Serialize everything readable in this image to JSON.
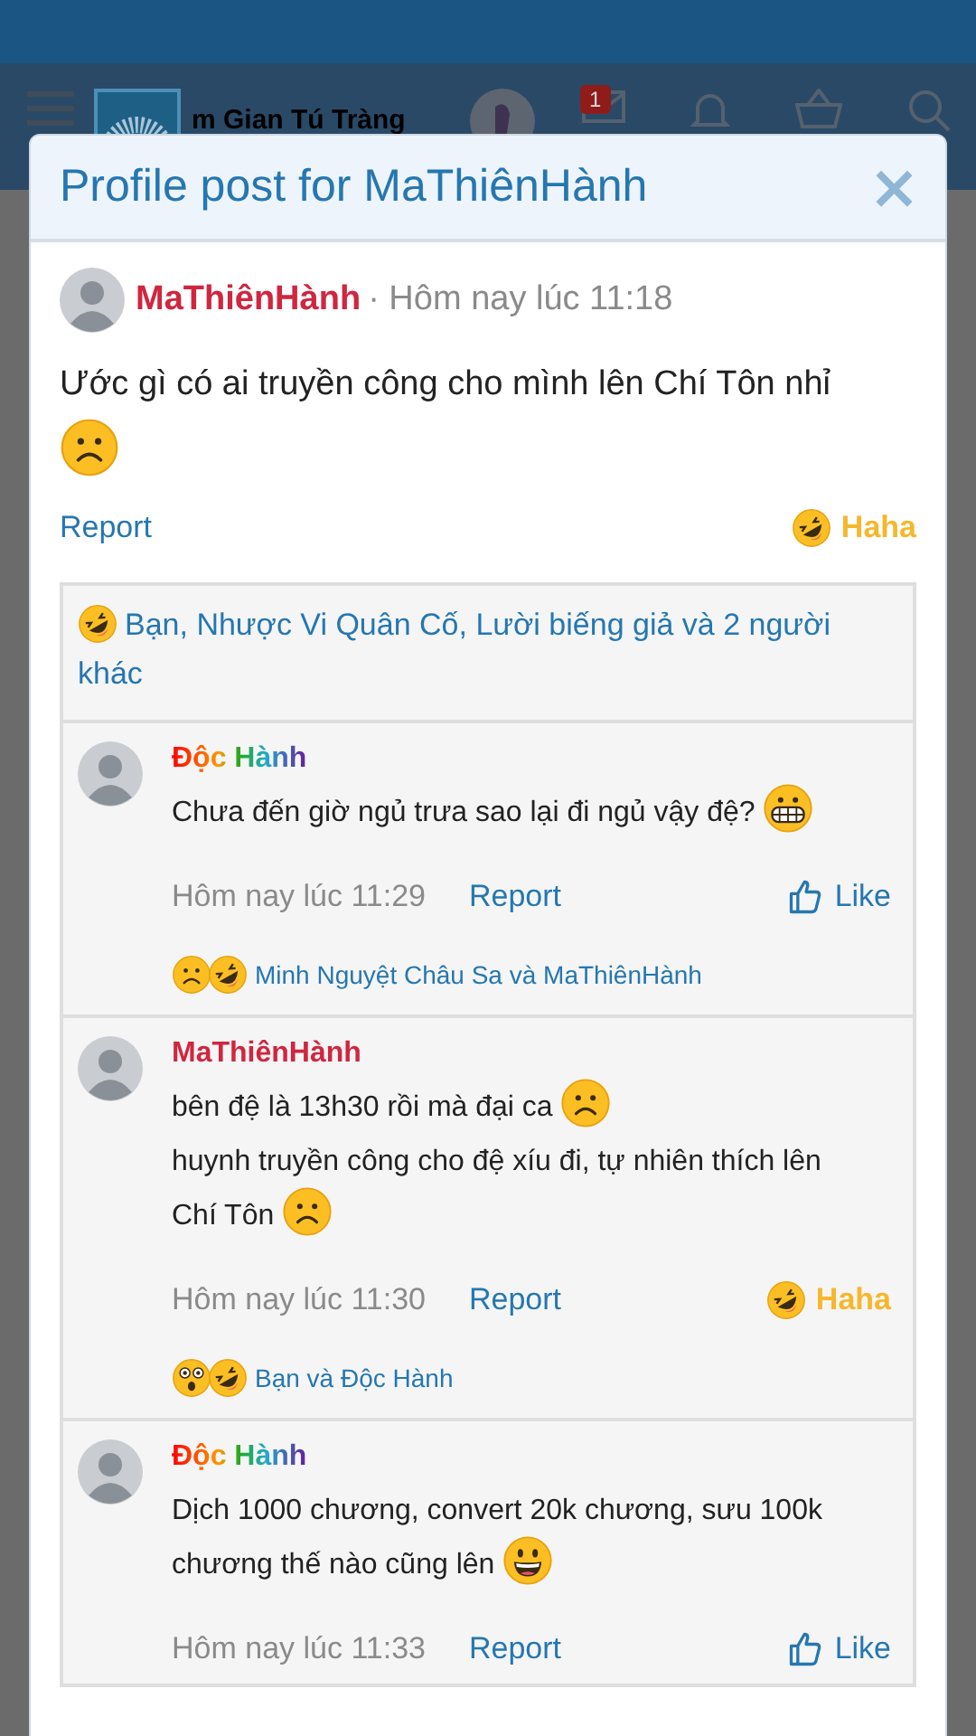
{
  "site_header": {
    "site_title": "m Gian Tú Tràng",
    "badge": "1"
  },
  "dialog": {
    "title": "Profile post for MaThiênHành",
    "close": "×"
  },
  "post": {
    "author": {
      "name": "MaThiênHành",
      "kind": "red"
    },
    "time": "· Hôm nay lúc 11:18",
    "content": [
      {
        "kind": "text",
        "text": "Ước gì có ai truyền công cho mình lên Chí Tôn nhỉ"
      },
      {
        "kind": "break"
      },
      {
        "kind": "frown"
      }
    ],
    "report": "Report",
    "reaction": {
      "kind": "haha",
      "label": "Haha",
      "selected": true
    },
    "summary": {
      "emojis": [
        {
          "kind": "haha"
        }
      ],
      "text": "Bạn, Nhược Vi Quân Cố, Lười biếng giả và 2 người khác"
    }
  },
  "comments": [
    {
      "author": {
        "name": "Độc Hành",
        "kind": "rainbow"
      },
      "content": [
        {
          "kind": "text",
          "text": "Chưa đến giờ ngủ trưa sao lại đi ngủ vậy đệ?"
        },
        {
          "kind": "grimace"
        }
      ],
      "time": "Hôm nay lúc 11:29",
      "report": "Report",
      "reaction": {
        "kind": "like",
        "label": "Like",
        "selected": false
      },
      "summary": {
        "emojis": [
          {
            "kind": "frown"
          },
          {
            "kind": "haha"
          }
        ],
        "text": "Minh Nguyệt Châu Sa và MaThiênHành"
      }
    },
    {
      "author": {
        "name": "MaThiênHành",
        "kind": "red"
      },
      "content": [
        {
          "kind": "text",
          "text": "bên đệ là 13h30 rồi mà đại ca"
        },
        {
          "kind": "frown"
        },
        {
          "kind": "break"
        },
        {
          "kind": "text",
          "text": "huynh truyền công cho đệ xíu đi, tự nhiên thích lên"
        },
        {
          "kind": "break"
        },
        {
          "kind": "text",
          "text": "Chí Tôn"
        },
        {
          "kind": "frown"
        }
      ],
      "time": "Hôm nay lúc 11:30",
      "report": "Report",
      "reaction": {
        "kind": "haha",
        "label": "Haha",
        "selected": true
      },
      "summary": {
        "emojis": [
          {
            "kind": "astonished"
          },
          {
            "kind": "haha"
          }
        ],
        "text": "Bạn và Độc Hành"
      }
    },
    {
      "author": {
        "name": "Độc Hành",
        "kind": "rainbow"
      },
      "content": [
        {
          "kind": "text",
          "text": "Dịch 1000 chương, convert 20k chương, sưu 100k"
        },
        {
          "kind": "break"
        },
        {
          "kind": "text",
          "text": "chương thế nào cũng lên"
        },
        {
          "kind": "grinning"
        }
      ],
      "time": "Hôm nay lúc 11:33",
      "report": "Report",
      "reaction": {
        "kind": "like",
        "label": "Like",
        "selected": false
      }
    }
  ]
}
